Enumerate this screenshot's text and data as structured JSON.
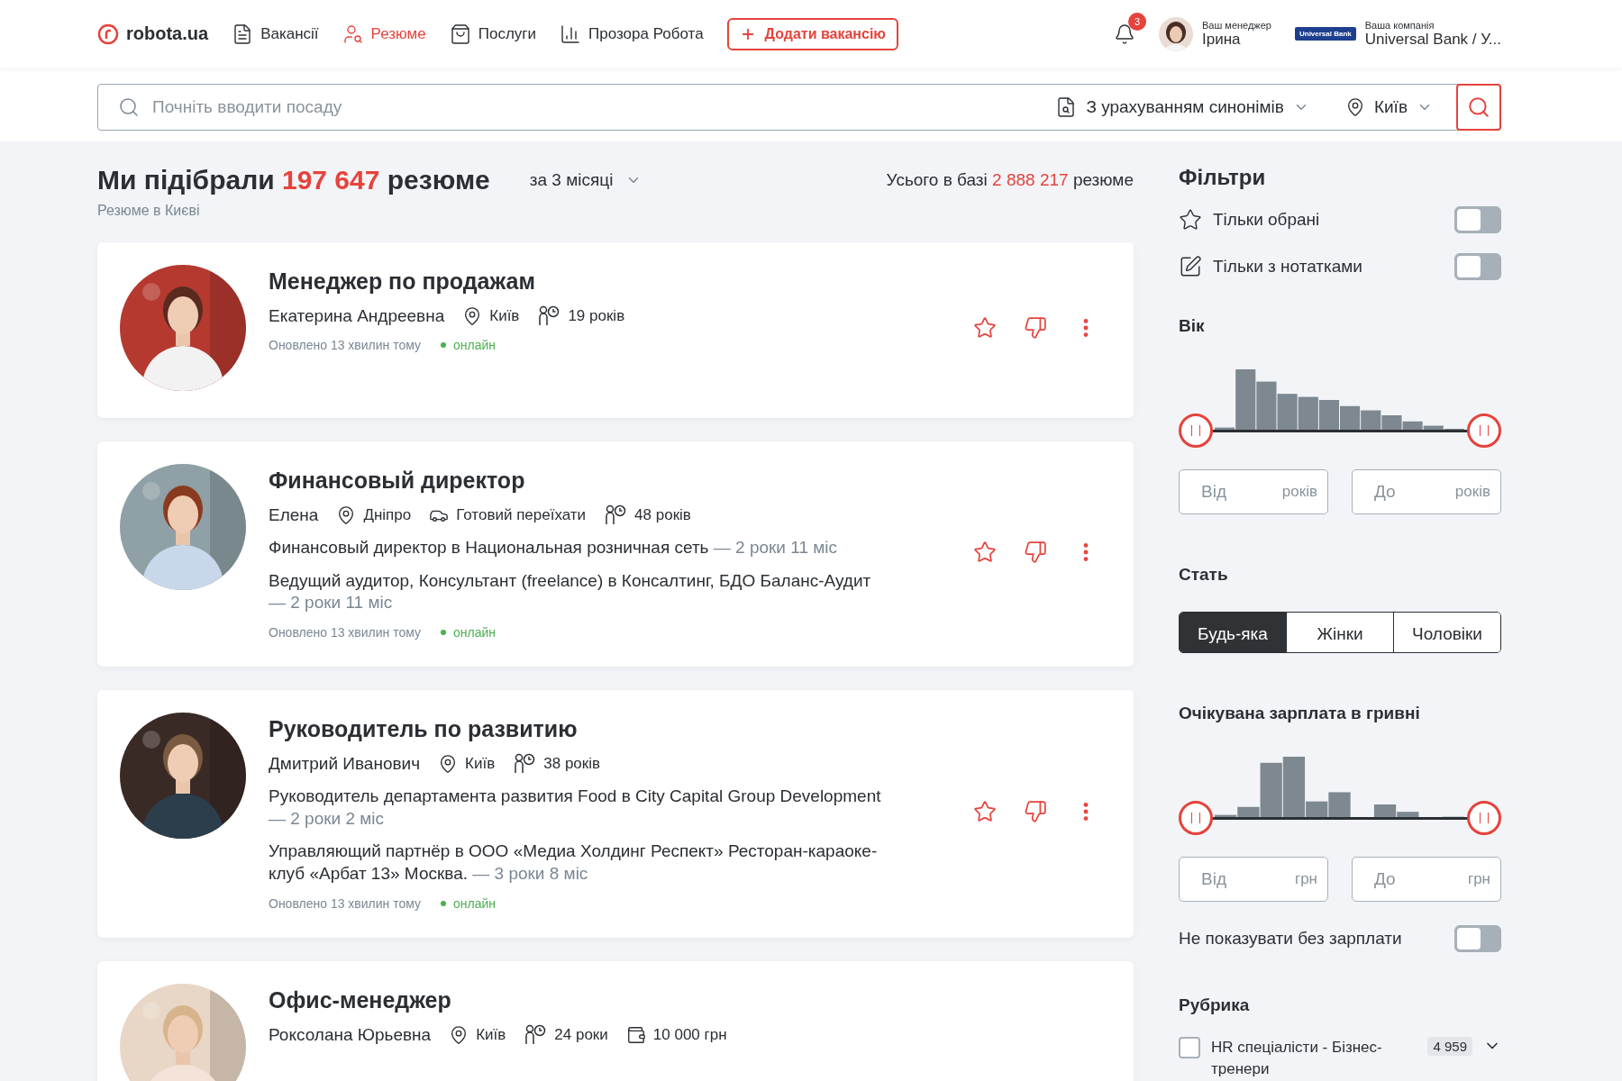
{
  "header": {
    "logo": "robota.ua",
    "nav": [
      {
        "label": "Вакансії",
        "selected": false
      },
      {
        "label": "Резюме",
        "selected": true
      },
      {
        "label": "Послуги",
        "selected": false
      },
      {
        "label": "Прозора Робота",
        "selected": false
      }
    ],
    "add_button": "Додати вакансію",
    "notifications": "3",
    "manager": {
      "caption": "Ваш менеджер",
      "name": "Ірина"
    },
    "company": {
      "caption": "Ваша компанія",
      "name": "Universal Bank / У...",
      "logo_text": "Universal Bank"
    }
  },
  "search": {
    "placeholder": "Почніть вводити посаду",
    "mode": "З урахуванням синонімів",
    "city": "Київ"
  },
  "results": {
    "prefix": "Ми підібрали",
    "count": "197 647",
    "suffix": "резюме",
    "period": "за 3 місяці",
    "subtitle": "Резюме в Києві",
    "total": {
      "prefix": "Усього в базі",
      "count": "2 888 217",
      "suffix": "резюме"
    }
  },
  "cards": [
    {
      "title": "Менеджер по продажам",
      "name": "Екатерина Андреевна",
      "meta": [
        {
          "kind": "location",
          "text": "Київ"
        },
        {
          "kind": "age",
          "text": "19 років"
        }
      ],
      "updated": "Оновлено 13 хвилин тому",
      "status": "онлайн"
    },
    {
      "title": "Финансовый директор",
      "name": "Елена",
      "meta": [
        {
          "kind": "location",
          "text": "Дніпро"
        },
        {
          "kind": "relocation",
          "text": "Готовий переїхати"
        },
        {
          "kind": "age",
          "text": "48 років"
        }
      ],
      "experience": [
        {
          "text": "Финансовый директор в Национальная розничная сеть",
          "duration": "— 2 роки 11 міс"
        },
        {
          "text": "Ведущий аудитор, Консультант (freelance) в Консалтинг, БДО Баланс-Аудит",
          "duration": "— 2 роки 11 міс"
        }
      ],
      "updated": "Оновлено 13 хвилин тому",
      "status": "онлайн"
    },
    {
      "title": "Руководитель по развитию",
      "name": "Дмитрий Иванович",
      "meta": [
        {
          "kind": "location",
          "text": "Київ"
        },
        {
          "kind": "age",
          "text": "38 років"
        }
      ],
      "experience": [
        {
          "text": "Руководитель департамента развития Food в City Capital Group Development",
          "duration": "— 2 роки 2 міс"
        },
        {
          "text": "Управляющий партнёр в ООО «Медиа Холдинг Респект» Ресторан-караоке-клуб «Арбат 13» Москва.",
          "duration": "— 3 роки 8 міс"
        }
      ],
      "updated": "Оновлено 13 хвилин тому",
      "status": "онлайн"
    },
    {
      "title": "Офис-менеджер",
      "name": "Роксолана Юрьевна",
      "meta": [
        {
          "kind": "location",
          "text": "Київ"
        },
        {
          "kind": "age",
          "text": "24 роки"
        },
        {
          "kind": "salary",
          "text": "10 000 грн"
        }
      ]
    }
  ],
  "filters": {
    "title": "Фільтри",
    "toggles": [
      {
        "label": "Тільки обрані",
        "on": false
      },
      {
        "label": "Тільки з нотатками",
        "on": false
      }
    ],
    "age": {
      "title": "Вік",
      "from": {
        "placeholder": "Від",
        "unit": "років"
      },
      "to": {
        "placeholder": "До",
        "unit": "років"
      }
    },
    "gender": {
      "title": "Стать",
      "options": [
        {
          "label": "Будь-яка",
          "selected": true
        },
        {
          "label": "Жінки",
          "selected": false
        },
        {
          "label": "Чоловіки",
          "selected": false
        }
      ]
    },
    "salary": {
      "title": "Очікувана зарплата в гривні",
      "from": {
        "placeholder": "Від",
        "unit": "грн"
      },
      "to": {
        "placeholder": "До",
        "unit": "грн"
      },
      "toggle": {
        "label": "Не показувати без зарплати",
        "on": false
      }
    },
    "rubric": {
      "title": "Рубрика",
      "items": [
        {
          "label": "HR спеціалісти - Бізнес-тренери",
          "count": "4 959",
          "checked": false
        }
      ]
    }
  }
}
